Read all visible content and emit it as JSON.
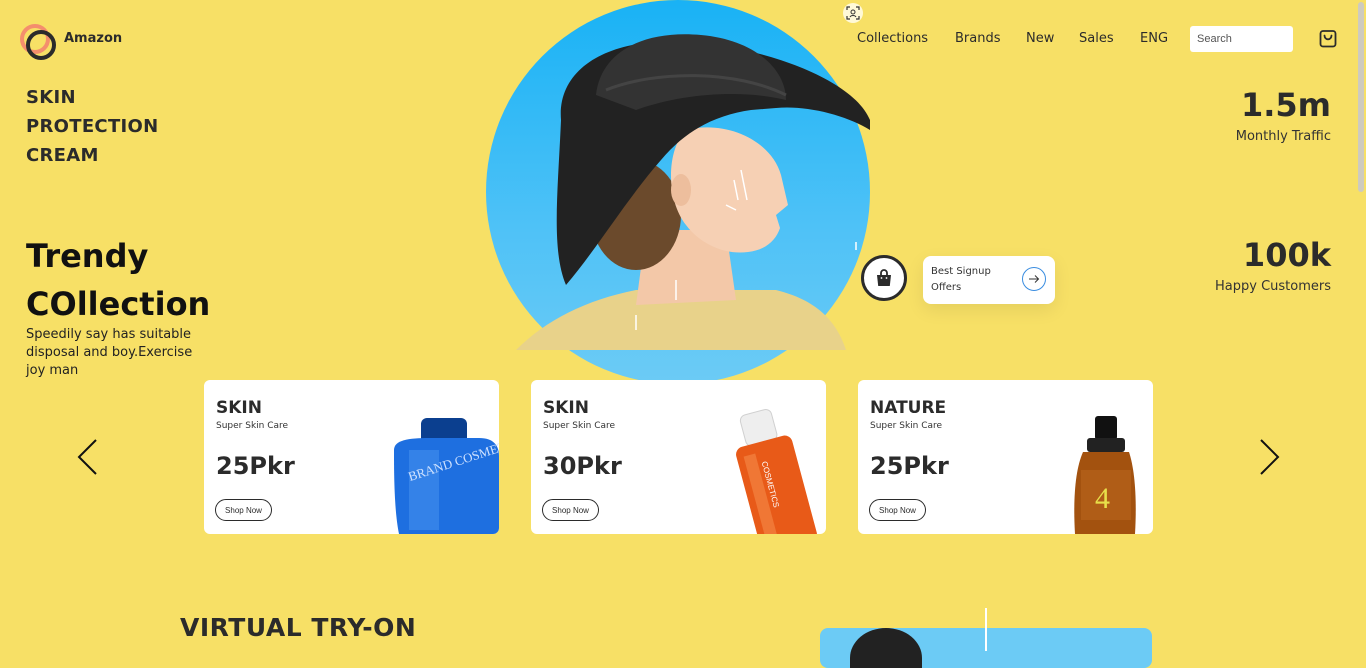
{
  "header": {
    "brand": "Amazon",
    "nav": [
      "Collections",
      "Brands",
      "New",
      "Sales",
      "ENG"
    ],
    "search_placeholder": "Search",
    "icons": {
      "logo": "logo-rings",
      "cart": "shopping-bag-icon",
      "scan": "scan-icon"
    }
  },
  "hero_left": {
    "heading_lines": [
      "SKIN",
      "PROTECTION",
      "CREAM"
    ],
    "title_lines": [
      "Trendy",
      "COllection"
    ],
    "description": "Speedily say has suitable disposal and boy.Exercise joy man"
  },
  "stats": [
    {
      "value": "1.5m",
      "label": "Monthly Traffic"
    },
    {
      "value": "100k",
      "label": "Happy Customers"
    }
  ],
  "offer": {
    "text": "Best Signup Offers",
    "icon": "arrow-right-icon"
  },
  "cards": [
    {
      "title": "SKIN",
      "subtitle": "Super Skin Care",
      "price": "25Pkr",
      "button": "Shop Now",
      "product_label": "BRAND COSMETICS"
    },
    {
      "title": "SKIN",
      "subtitle": "Super Skin Care",
      "price": "30Pkr",
      "button": "Shop Now",
      "product_label": "COSMETICS"
    },
    {
      "title": "NATURE",
      "subtitle": "Super Skin Care",
      "price": "25Pkr",
      "button": "Shop Now",
      "product_label": "4"
    }
  ],
  "section": {
    "title": "VIRTUAL TRY-ON"
  },
  "colors": {
    "background": "#F7E066",
    "hero_blue": "#19B2F5",
    "accent_orange": "#F48E6D",
    "text_dark": "#2b2b2b"
  }
}
